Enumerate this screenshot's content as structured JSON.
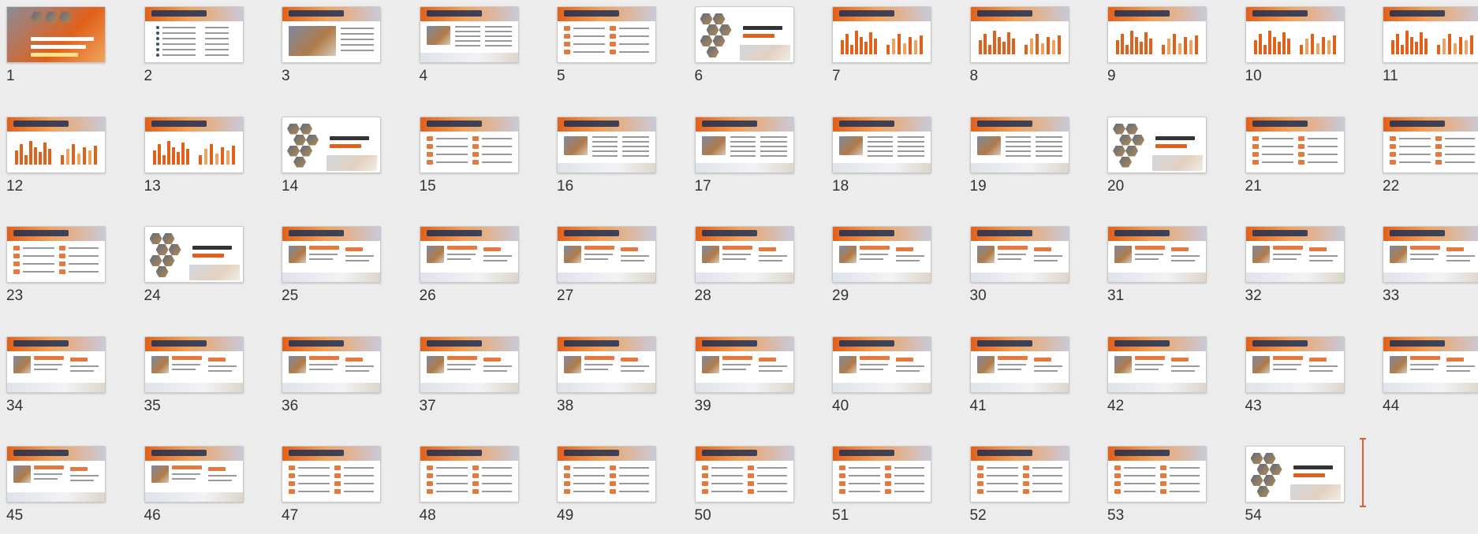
{
  "app": "Slide Sorter",
  "slides": [
    {
      "number": "1",
      "variant": "title"
    },
    {
      "number": "2",
      "variant": "agenda"
    },
    {
      "number": "3",
      "variant": "section"
    },
    {
      "number": "4",
      "variant": "text"
    },
    {
      "number": "5",
      "variant": "list"
    },
    {
      "number": "6",
      "variant": "hex"
    },
    {
      "number": "7",
      "variant": "chart"
    },
    {
      "number": "8",
      "variant": "chart"
    },
    {
      "number": "9",
      "variant": "chart"
    },
    {
      "number": "10",
      "variant": "chart"
    },
    {
      "number": "11",
      "variant": "chart"
    },
    {
      "number": "12",
      "variant": "chart"
    },
    {
      "number": "13",
      "variant": "chart"
    },
    {
      "number": "14",
      "variant": "hex"
    },
    {
      "number": "15",
      "variant": "list"
    },
    {
      "number": "16",
      "variant": "text"
    },
    {
      "number": "17",
      "variant": "text"
    },
    {
      "number": "18",
      "variant": "text"
    },
    {
      "number": "19",
      "variant": "text"
    },
    {
      "number": "20",
      "variant": "hex"
    },
    {
      "number": "21",
      "variant": "list"
    },
    {
      "number": "22",
      "variant": "list"
    },
    {
      "number": "23",
      "variant": "list"
    },
    {
      "number": "24",
      "variant": "hex"
    },
    {
      "number": "25",
      "variant": "photo"
    },
    {
      "number": "26",
      "variant": "photo"
    },
    {
      "number": "27",
      "variant": "photo"
    },
    {
      "number": "28",
      "variant": "photo"
    },
    {
      "number": "29",
      "variant": "photo"
    },
    {
      "number": "30",
      "variant": "photo"
    },
    {
      "number": "31",
      "variant": "photo"
    },
    {
      "number": "32",
      "variant": "photo"
    },
    {
      "number": "33",
      "variant": "photo"
    },
    {
      "number": "34",
      "variant": "photo"
    },
    {
      "number": "35",
      "variant": "photo"
    },
    {
      "number": "36",
      "variant": "photo"
    },
    {
      "number": "37",
      "variant": "photo"
    },
    {
      "number": "38",
      "variant": "photo"
    },
    {
      "number": "39",
      "variant": "photo"
    },
    {
      "number": "40",
      "variant": "photo"
    },
    {
      "number": "41",
      "variant": "photo"
    },
    {
      "number": "42",
      "variant": "photo"
    },
    {
      "number": "43",
      "variant": "photo"
    },
    {
      "number": "44",
      "variant": "photo"
    },
    {
      "number": "45",
      "variant": "photo"
    },
    {
      "number": "46",
      "variant": "photo"
    },
    {
      "number": "47",
      "variant": "list"
    },
    {
      "number": "48",
      "variant": "list"
    },
    {
      "number": "49",
      "variant": "list"
    },
    {
      "number": "50",
      "variant": "list"
    },
    {
      "number": "51",
      "variant": "list"
    },
    {
      "number": "52",
      "variant": "list"
    },
    {
      "number": "53",
      "variant": "list"
    },
    {
      "number": "54",
      "variant": "hex"
    }
  ],
  "colors": {
    "accent": "#e0611b",
    "navy": "#1f2f52",
    "insertion_marker": "#d2603d",
    "background": "#ececec"
  }
}
